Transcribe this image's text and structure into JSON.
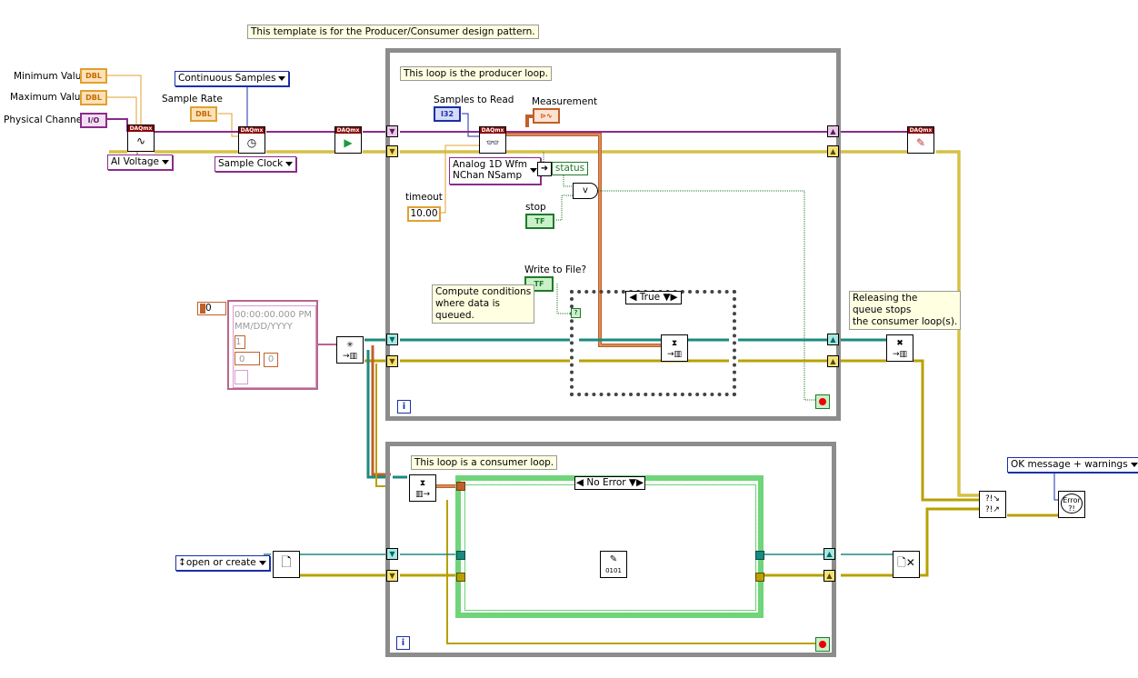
{
  "notes": {
    "template": "This template is for the Producer/Consumer design pattern.",
    "producer": "This loop is the producer loop.",
    "consumer": "This loop is a consumer loop.",
    "compute_line1": "Compute conditions",
    "compute_line2": "where data is",
    "compute_line3": "queued.",
    "release_line1": "Releasing the",
    "release_line2": "queue stops",
    "release_line3": "the consumer loop(s)."
  },
  "labels": {
    "min_value": "Minimum Value",
    "max_value": "Maximum Value",
    "physical_channel": "Physical Channel",
    "sample_rate": "Sample Rate",
    "samples_to_read": "Samples to Read",
    "measurement": "Measurement",
    "timeout": "timeout",
    "stop": "stop",
    "write_to_file": "Write to File?",
    "status": "status"
  },
  "terminals": {
    "dbl": "DBL",
    "io": "I/O",
    "i32": "I32",
    "tf": "TF",
    "timeout_value": "10.00",
    "zero_const": "0"
  },
  "enums": {
    "continuous_samples": "Continuous Samples",
    "ai_voltage": "AI Voltage",
    "sample_clock": "Sample Clock",
    "read_type_line1": "Analog 1D Wfm",
    "read_type_line2": "NChan NSamp",
    "open_or_create": "open or create",
    "ok_message": "OK message + warnings"
  },
  "cases": {
    "producer_case": "True",
    "consumer_case": "No Error"
  },
  "cluster": {
    "timestamp": "00:00:00.000 PM",
    "date": "MM/DD/YYYY",
    "num1": "1",
    "num2": "0",
    "num3": "0"
  },
  "vi_headers": {
    "daqmx": "DAQmx"
  },
  "iteration": "i",
  "colors": {
    "dbl_orange": "#e0a030",
    "enum_blue": "#1a2fa8",
    "bool_green": "#1f7a2a",
    "task_purple": "#8b2b8b",
    "error_yellow": "#b8a000",
    "refnum_teal": "#1a8a80",
    "waveform_brown": "#c0602a",
    "loop_gray": "#8c8c8c"
  }
}
